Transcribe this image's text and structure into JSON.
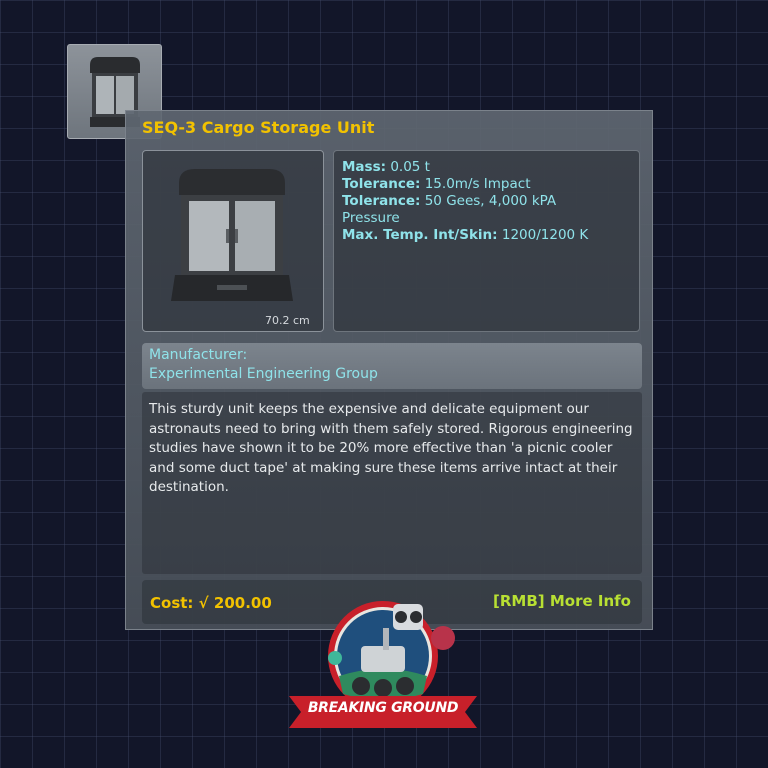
{
  "part": {
    "title": "SEQ-3 Cargo Storage Unit",
    "size": "70.2 cm"
  },
  "stats": {
    "mass_label": "Mass:",
    "mass_value": "0.05 t",
    "tolerance1_label": "Tolerance:",
    "tolerance1_value": "15.0m/s Impact",
    "tolerance2_label": "Tolerance:",
    "tolerance2_value": "50 Gees, 4,000 kPA",
    "tolerance2_cont": "Pressure",
    "maxtemp_label": "Max. Temp. Int/Skin:",
    "maxtemp_value": "1200/1200 K"
  },
  "manufacturer": {
    "label": "Manufacturer:",
    "name": "Experimental Engineering Group"
  },
  "description": "This sturdy unit keeps the expensive and delicate equipment our astronauts need to bring with them safely stored.  Rigorous engineering studies have shown it to be 20% more effective than 'a picnic cooler and some duct tape' at making sure these items arrive intact at their destination.",
  "footer": {
    "cost_label": "Cost:",
    "cost_symbol": "√",
    "cost_value": "200.00",
    "more_info": "[RMB] More Info"
  },
  "logo": {
    "text": "BREAKING GROUND"
  },
  "colors": {
    "title": "#f2c200",
    "stat_text": "#8fe3ea",
    "more_info": "#b8e033",
    "background": "#121629"
  }
}
